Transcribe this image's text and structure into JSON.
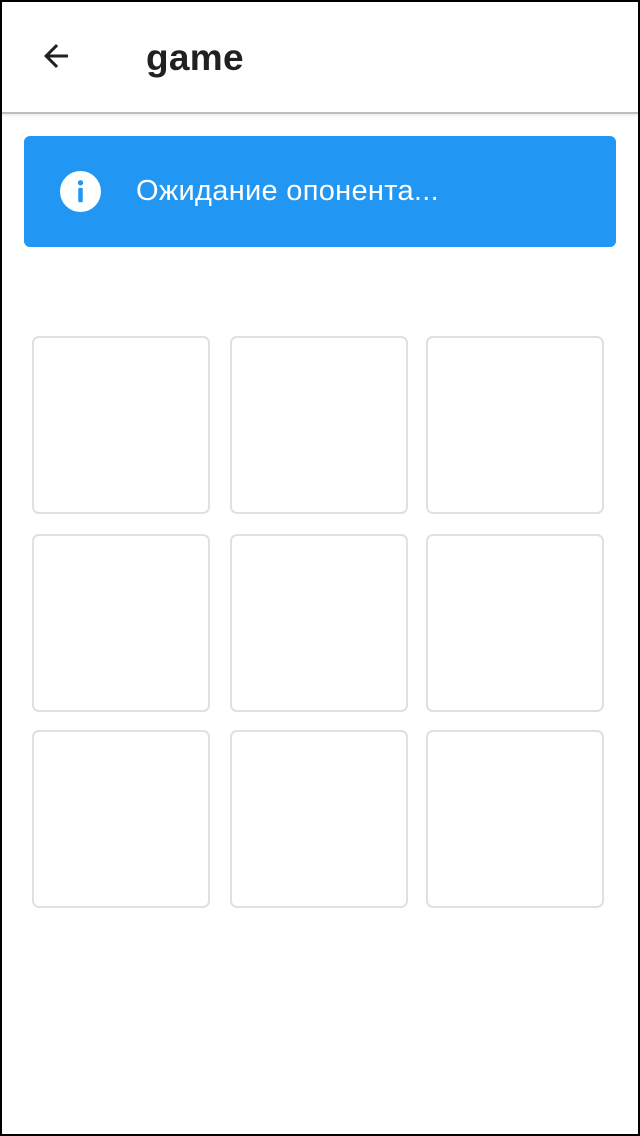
{
  "app_bar": {
    "title": "game",
    "back_icon": "arrow-left-icon"
  },
  "status_banner": {
    "icon": "info-icon",
    "message": "Ожидание опонента...",
    "background_color": "#2196f3",
    "text_color": "#ffffff"
  },
  "board": {
    "rows": 3,
    "columns": 3,
    "cells": [
      "",
      "",
      "",
      "",
      "",
      "",
      "",
      "",
      ""
    ]
  }
}
